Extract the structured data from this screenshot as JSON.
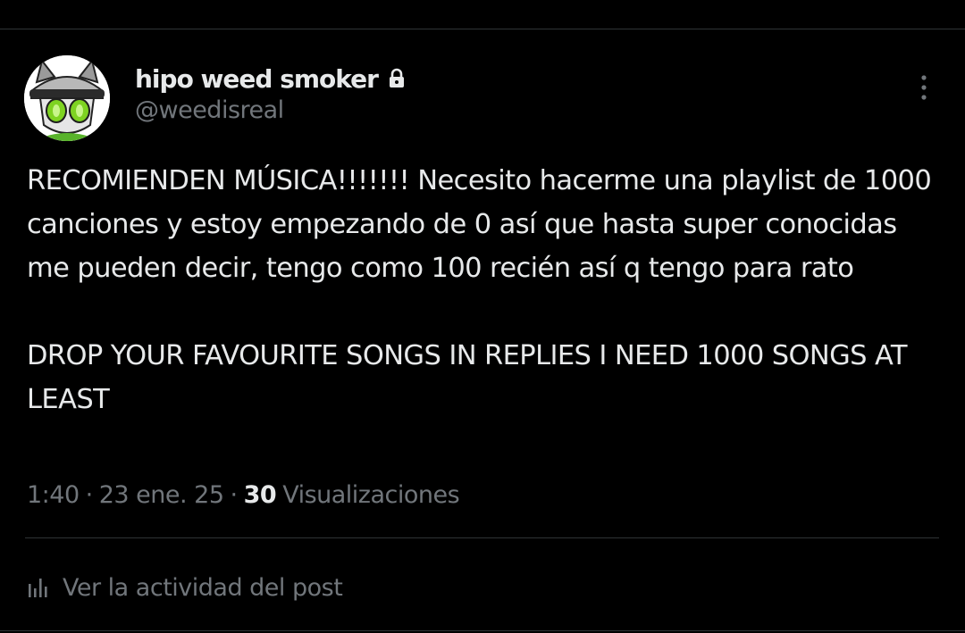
{
  "author": {
    "display_name": "hipo weed smoker",
    "handle": "@weedisreal",
    "protected_icon": "lock-icon",
    "avatar_icon": "anime-character-avatar"
  },
  "menu": {
    "more_icon": "more-vertical-icon"
  },
  "post": {
    "paragraphs": [
      "RECOMIENDEN MÚSICA!!!!!!! Necesito hacerme una playlist de 1000 canciones y estoy empezando de 0 así que hasta super conocidas me pueden decir, tengo como 100 recién así q tengo para rato",
      "DROP YOUR FAVOURITE SONGS IN REPLIES I NEED 1000 SONGS AT LEAST"
    ]
  },
  "meta": {
    "time": "1:40",
    "separator": "·",
    "date": "23 ene. 25",
    "views_count": "30",
    "views_label": "Visualizaciones"
  },
  "activity": {
    "label": "Ver la actividad del post",
    "icon": "analytics-bars-icon"
  },
  "colors": {
    "background": "#000000",
    "text_primary": "#e7e9ea",
    "text_secondary": "#71767b",
    "divider": "#2f3336",
    "avatar_accent_green": "#7ed321"
  }
}
